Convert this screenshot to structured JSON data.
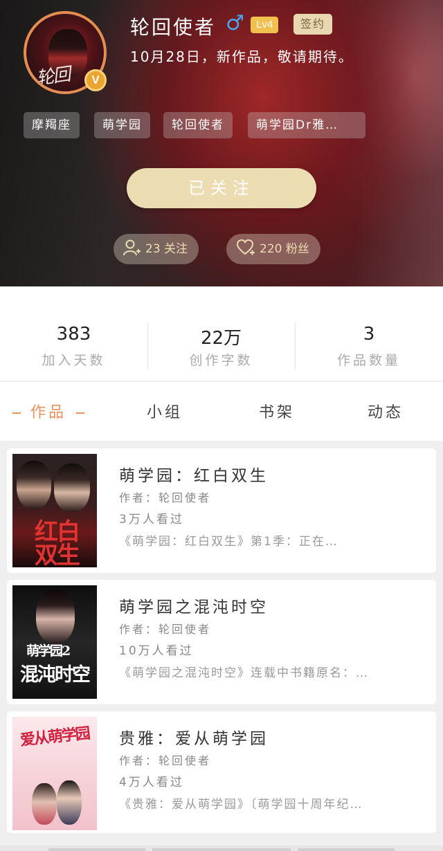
{
  "profile": {
    "username": "轮回使者",
    "gender_symbol": "♂",
    "level": "Lv4",
    "signed_badge": "签约",
    "verified_mark": "V",
    "avatar_signature": "轮回",
    "motto": "10月28日，新作品，敬请期待。",
    "tags": [
      "摩羯座",
      "萌学园",
      "轮回使者",
      "萌学园Dr雅…"
    ]
  },
  "actions": {
    "follow_label": "已关注",
    "following": "23 关注",
    "fans": "220 粉丝"
  },
  "stats": [
    {
      "value": "383",
      "label": "加入天数"
    },
    {
      "value": "22万",
      "label": "创作字数"
    },
    {
      "value": "3",
      "label": "作品数量"
    }
  ],
  "tabs": [
    "作品",
    "小组",
    "书架",
    "动态"
  ],
  "books": [
    {
      "title": "萌学园：红白双生",
      "author": "作者：轮回使者",
      "views": "3万人看过",
      "desc": "《萌学园：红白双生》第1季：正在…",
      "cover_text": "红白双生"
    },
    {
      "title": "萌学园之混沌时空",
      "author": "作者：轮回使者",
      "views": "10万人看过",
      "desc": "《萌学园之混沌时空》连载中书籍原名：…",
      "cover_text": "混沌时空",
      "cover_subtext": "萌学园2"
    },
    {
      "title": "贵雅：爱从萌学园",
      "author": "作者：轮回使者",
      "views": "4万人看过",
      "desc": "《贵雅：爱从萌学园》〔萌学园十周年纪…",
      "cover_text": "爱从萌学园"
    }
  ],
  "colors": {
    "accent": "#e9915a",
    "follow_button": "#ecdcb2",
    "level_badge": "#f1c04e",
    "gender": "#4aa4ef"
  }
}
